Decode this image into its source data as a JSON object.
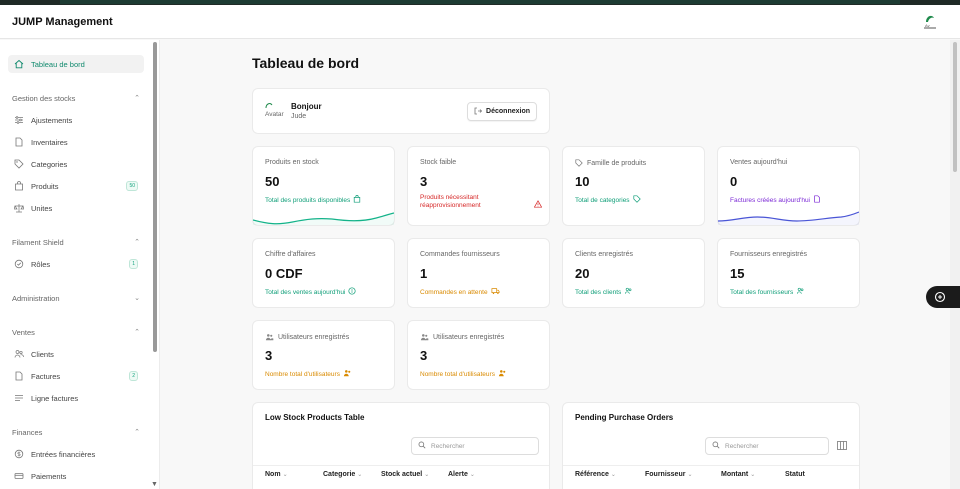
{
  "app": {
    "title": "JUMP Management"
  },
  "sidebar": {
    "dashboard": "Tableau de bord",
    "groups": {
      "stocks": "Gestion des stocks",
      "shield": "Filament Shield",
      "admin": "Administration",
      "ventes": "Ventes",
      "finances": "Finances"
    },
    "items": {
      "ajustements": "Ajustements",
      "inventaires": "Inventaires",
      "categories": "Categories",
      "produits": "Produits",
      "produits_badge": "50",
      "unites": "Unites",
      "roles": "Rôles",
      "roles_badge": "1",
      "clients": "Clients",
      "factures": "Factures",
      "factures_badge": "2",
      "ligne_factures": "Ligne factures",
      "entrees": "Entrées financières",
      "paiements": "Paiements"
    }
  },
  "page": {
    "title": "Tableau de bord"
  },
  "user": {
    "avatar_alt": "Avatar",
    "greeting": "Bonjour",
    "name": "Jude",
    "logout": "Déconnexion"
  },
  "stats": [
    {
      "label": "Produits en stock",
      "value": "50",
      "desc": "Total des produits disponibles",
      "color": "#0f9e78"
    },
    {
      "label": "Stock faible",
      "value": "3",
      "desc_line1": "Produits nécessitant",
      "desc_line2": "réapprovisionnement",
      "color": "#d62828"
    },
    {
      "label": "Famille de produits",
      "value": "10",
      "desc": "Total de categories",
      "color": "#0f9e78"
    },
    {
      "label": "Ventes aujourd'hui",
      "value": "0",
      "desc": "Factures créées aujourd'hui",
      "color": "#7c2ad6"
    },
    {
      "label": "Chiffre d'affaires",
      "value": "0 CDF",
      "desc": "Total des ventes aujourd'hui",
      "color": "#0f9e78"
    },
    {
      "label": "Commandes fournisseurs",
      "value": "1",
      "desc": "Commandes en attente",
      "color": "#d98a00"
    },
    {
      "label": "Clients enregistrés",
      "value": "20",
      "desc": "Total des clients",
      "color": "#0f9e78"
    },
    {
      "label": "Fournisseurs enregistrés",
      "value": "15",
      "desc": "Total des fournisseurs",
      "color": "#0f9e78"
    },
    {
      "label": "Utilisateurs enregistrés",
      "value": "3",
      "desc": "Nombre total d'utilisateurs",
      "color": "#d98a00"
    },
    {
      "label": "Utilisateurs enregistrés",
      "value": "3",
      "desc": "Nombre total d'utilisateurs",
      "color": "#d98a00"
    }
  ],
  "low_stock": {
    "title": "Low Stock Products Table",
    "search_placeholder": "Rechercher",
    "columns": [
      "Nom",
      "Categorie",
      "Stock actuel",
      "Alerte"
    ]
  },
  "pending_orders": {
    "title": "Pending Purchase Orders",
    "search_placeholder": "Rechercher",
    "columns": [
      "Référence",
      "Fournisseur",
      "Montant",
      "Statut"
    ]
  }
}
